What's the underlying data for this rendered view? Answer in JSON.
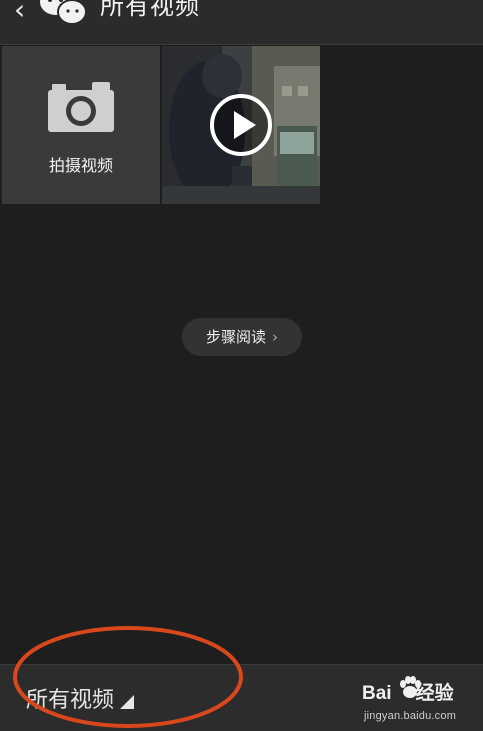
{
  "header": {
    "back_glyph": "‹",
    "title": "所有视频"
  },
  "grid": {
    "capture_label": "拍摄视频"
  },
  "step_reading": {
    "label": "步骤阅读",
    "chevron": "›"
  },
  "footer": {
    "album_label": "所有视频"
  },
  "watermark": {
    "brand_left": "Bai",
    "brand_right": "经验",
    "url": "jingyan.baidu.com"
  },
  "colors": {
    "background": "#1e1e1e",
    "bar": "#2c2c2c",
    "annotation": "#d9481c"
  }
}
